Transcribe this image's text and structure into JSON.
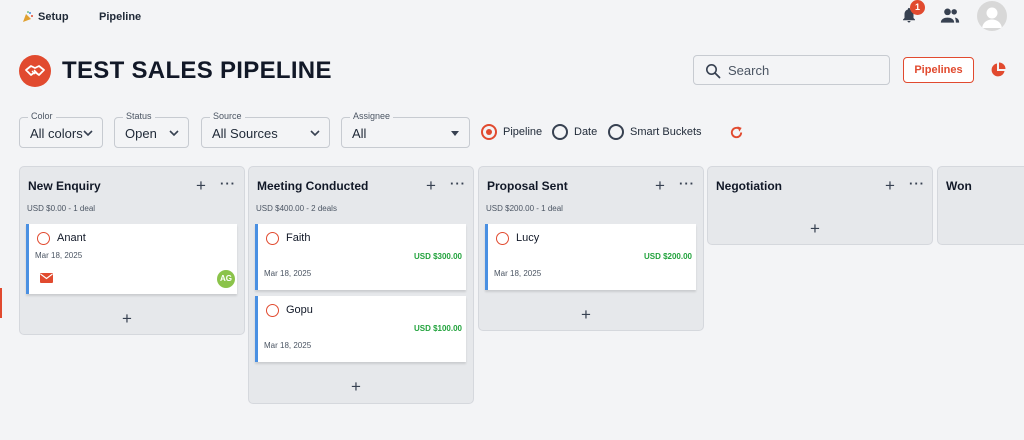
{
  "nav": {
    "setup": "Setup",
    "pipeline": "Pipeline"
  },
  "notifications": {
    "count": "1"
  },
  "header": {
    "title": "TEST SALES PIPELINE"
  },
  "search": {
    "placeholder": "Search",
    "value": ""
  },
  "pipelines_button": "Pipelines",
  "filters": [
    {
      "label": "Color",
      "value": "All colors"
    },
    {
      "label": "Status",
      "value": "Open"
    },
    {
      "label": "Source",
      "value": "All Sources"
    },
    {
      "label": "Assignee",
      "value": "All"
    }
  ],
  "view_mode": {
    "options": [
      "Pipeline",
      "Date",
      "Smart Buckets"
    ],
    "selected": "Pipeline"
  },
  "columns": [
    {
      "title": "New Enquiry",
      "summary": "USD $0.00 - 1 deal",
      "cards": [
        {
          "name": "Anant",
          "amount": "",
          "date": "Mar 18, 2025",
          "owner_initials": "AG"
        }
      ]
    },
    {
      "title": "Meeting Conducted",
      "summary": "USD $400.00 - 2 deals",
      "cards": [
        {
          "name": "Faith",
          "amount": "USD $300.00",
          "date": "Mar 18, 2025"
        },
        {
          "name": "Gopu",
          "amount": "USD $100.00",
          "date": "Mar 18, 2025"
        }
      ]
    },
    {
      "title": "Proposal Sent",
      "summary": "USD $200.00 - 1 deal",
      "cards": [
        {
          "name": "Lucy",
          "amount": "USD $200.00",
          "date": "Mar 18, 2025"
        }
      ]
    },
    {
      "title": "Negotiation",
      "summary": "",
      "cards": []
    },
    {
      "title": "Won",
      "summary": "",
      "cards": []
    }
  ],
  "colors": {
    "accent": "#e14a2f",
    "card_border": "#4a90e2",
    "amount": "#22a33d",
    "owner_avatar": "#8bc34a"
  }
}
